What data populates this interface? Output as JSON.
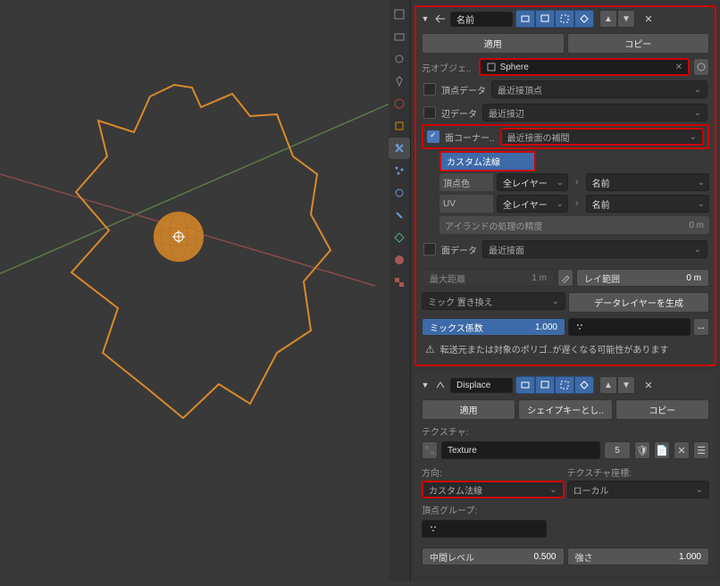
{
  "modifier1": {
    "name": "名前",
    "apply": "適用",
    "copy": "コピー",
    "src_object_label": "元オブジェ..",
    "src_object_value": "Sphere",
    "vertex_data_label": "頂点データ",
    "vertex_dd": "最近接頂点",
    "edge_data_label": "辺データ",
    "edge_dd": "最近接辺",
    "face_corner_label": "面コーナー..",
    "face_corner_dd": "最近接面の補間",
    "custom_normals": "カスタム法線",
    "vcol": "頂点色",
    "all_layers": "全レイヤー",
    "uv": "UV",
    "island_precision": "アイランドの処理の精度",
    "island_val": "0 m",
    "face_data_label": "面データ",
    "face_dd": "最近接面",
    "max_dist": "最大距離",
    "max_dist_val": "1 m",
    "ray_range": "レイ範囲",
    "ray_range_val": "0 m",
    "mix_label": "ミック",
    "mix_mode": "置き換え",
    "gen_layers": "データレイヤーを生成",
    "mix_factor": "ミックス係数",
    "mix_factor_val": "1.000",
    "warning": "転送元または対象のポリゴ..が遅くなる可能性があります"
  },
  "modifier2": {
    "name": "Displace",
    "apply": "適用",
    "shape_key": "シェイプキーとし..",
    "copy": "コピー",
    "texture_label": "テクスチャ:",
    "texture_value": "Texture",
    "texture_users": "5",
    "direction_label": "方向:",
    "direction_value": "カスタム法線",
    "tex_coord_label": "テクスチャ座標:",
    "tex_coord_value": "ローカル",
    "vgroup_label": "頂点グループ:",
    "mid_level": "中間レベル",
    "mid_level_val": "0.500",
    "strength": "強さ",
    "strength_val": "1.000"
  }
}
